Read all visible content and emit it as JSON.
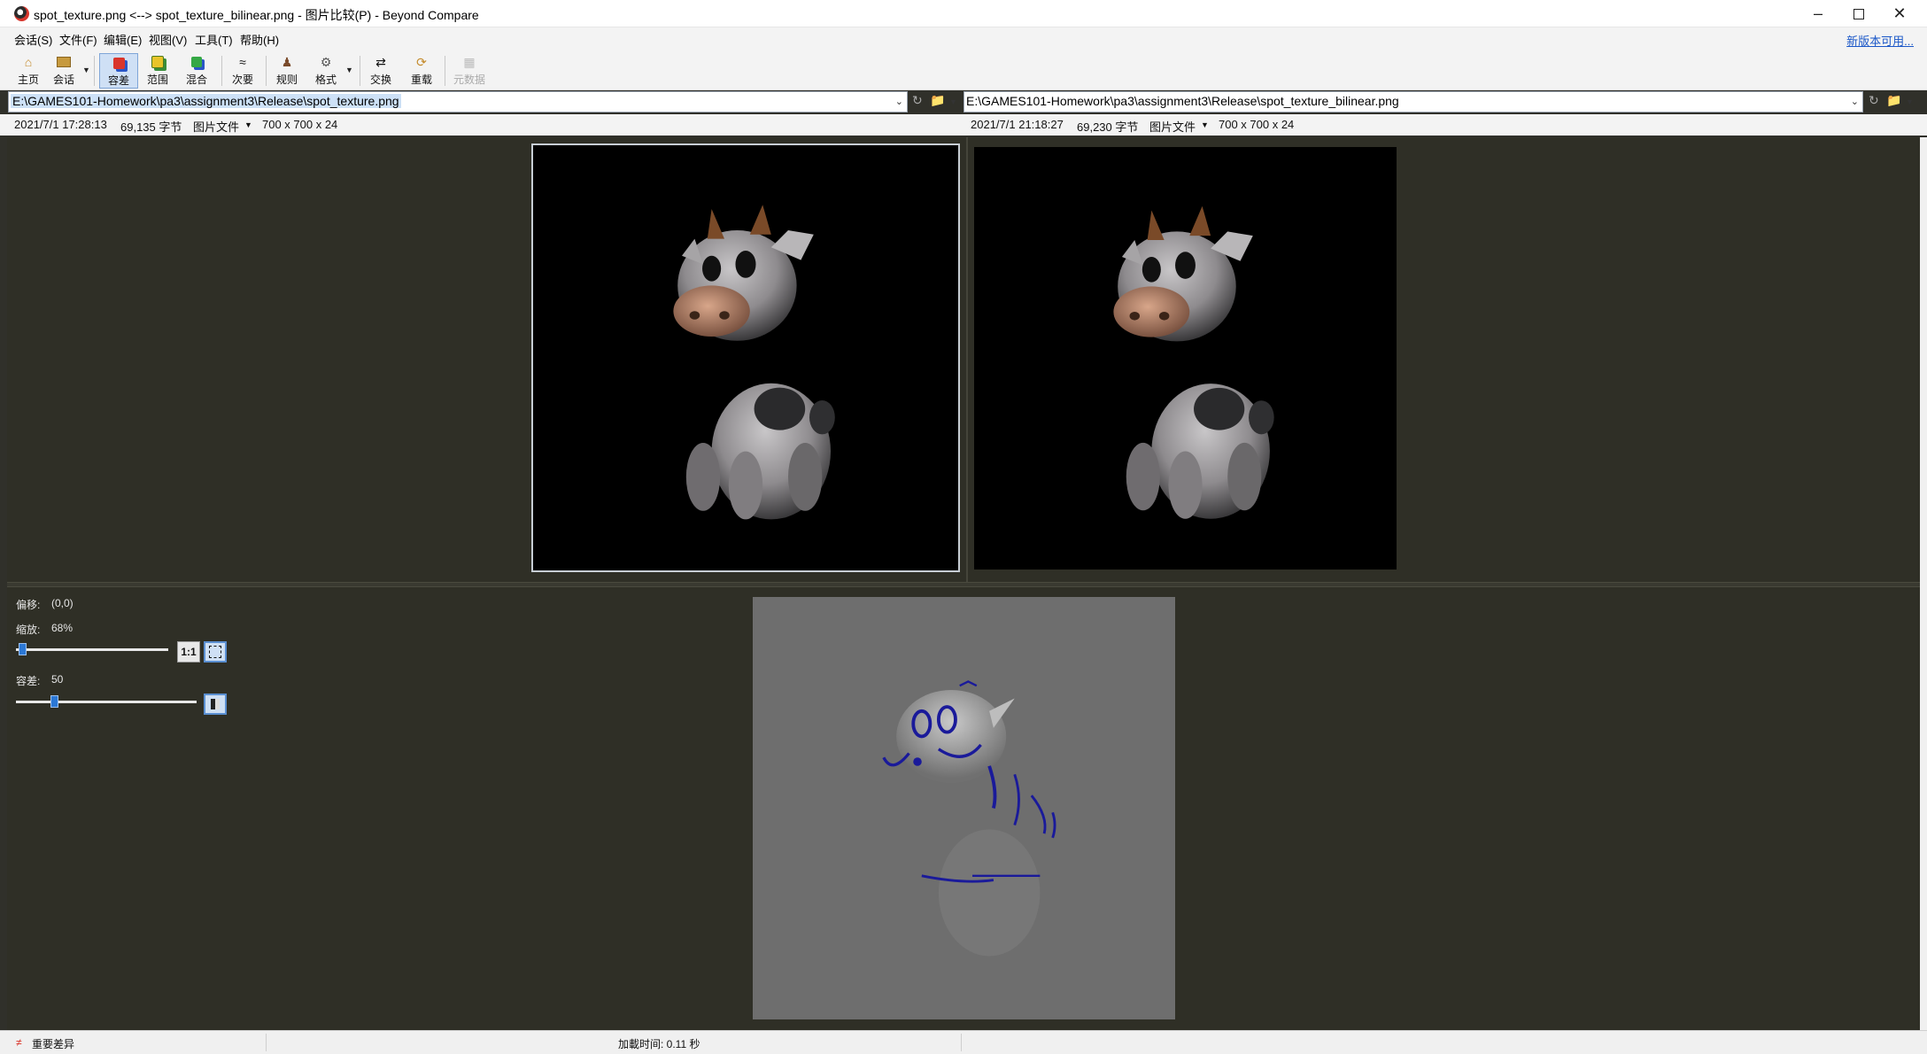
{
  "window": {
    "title": "spot_texture.png <--> spot_texture_bilinear.png - 图片比较(P) - Beyond Compare"
  },
  "menu": {
    "items": [
      "会话(S)",
      "文件(F)",
      "编辑(E)",
      "视图(V)",
      "工具(T)",
      "帮助(H)"
    ],
    "update_link": "新版本可用..."
  },
  "toolbar": {
    "home": "主页",
    "session": "会话",
    "diffs": "容差",
    "range": "范围",
    "blend": "混合",
    "minor": "次要",
    "rules": "规则",
    "format": "格式",
    "swap": "交换",
    "reload": "重载",
    "snapshot": "元数据"
  },
  "left_file": {
    "path": "E:\\GAMES101-Homework\\pa3\\assignment3\\Release\\spot_texture.png",
    "timestamp": "2021/7/1 17:28:13",
    "size": "69,135 字节",
    "format": "图片文件",
    "dimensions": "700 x 700 x 24"
  },
  "right_file": {
    "path": "E:\\GAMES101-Homework\\pa3\\assignment3\\Release\\spot_texture_bilinear.png",
    "timestamp": "2021/7/1 21:18:27",
    "size": "69,230 字节",
    "format": "图片文件",
    "dimensions": "700 x 700 x 24"
  },
  "controls": {
    "offset_label": "偏移:",
    "offset_value": "(0,0)",
    "zoom_label": "缩放:",
    "zoom_value": "68%",
    "zoom_level": 0.02,
    "actual_size_label": "1:1",
    "tolerance_label": "容差:",
    "tolerance_value": "50",
    "tolerance_level": 0.2
  },
  "status": {
    "important_diffs": "重要差异",
    "load_time": "加載时间: 0.11 秒"
  },
  "colors": {
    "accent": "#2b78d6",
    "pane_background": "#2f2f26",
    "diff_gray": "#6e6e6e",
    "diff_marks": "#1a1a9a"
  }
}
